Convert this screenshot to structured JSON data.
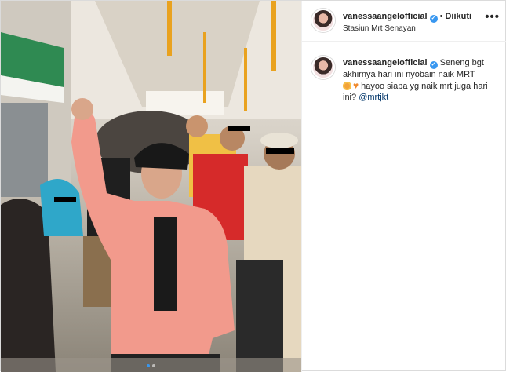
{
  "post": {
    "image_alt": "photo-carousel",
    "carousel": {
      "total": 2,
      "active": 1
    }
  },
  "header": {
    "username": "vanessaangelofficial",
    "verified_icon": "verified-badge-icon",
    "separator": "•",
    "follow_status": "Diikuti",
    "location": "Stasiun Mrt Senayan",
    "more_icon": "more-options-icon",
    "more_glyph": "•••"
  },
  "caption": {
    "username": "vanessaangelofficial",
    "text_1": "Seneng bgt akhirnya hari ini nyobain naik MRT",
    "text_2": "hayoo siapa yg naik mrt juga hari ini?",
    "mention": "@mrtjkt",
    "emojis": [
      "star-struck-emoji",
      "orange-heart-emoji"
    ]
  },
  "colors": {
    "accent": "#3897f0",
    "text": "#262626",
    "mention": "#003569",
    "border": "#dbdbdb"
  }
}
